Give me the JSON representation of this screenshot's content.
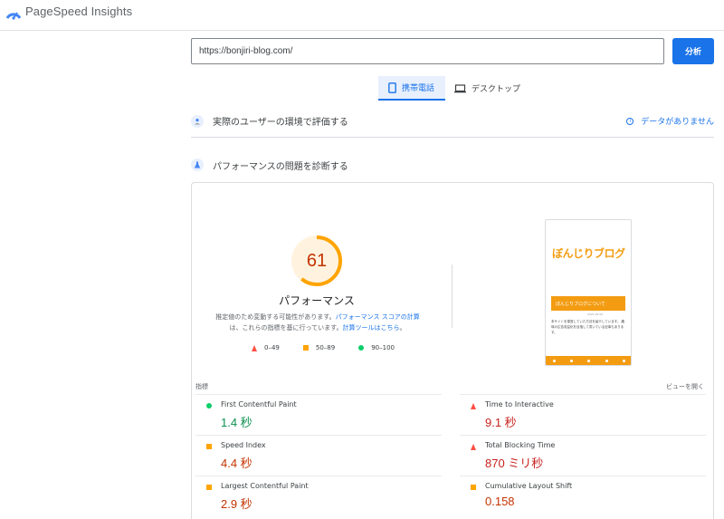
{
  "header": {
    "brand": "PageSpeed Insights"
  },
  "search": {
    "url": "https://bonjiri-blog.com/",
    "analyze_label": "分析"
  },
  "tabs": [
    {
      "label": "携帯電話",
      "active": true
    },
    {
      "label": "デスクトップ",
      "active": false
    }
  ],
  "field_section": {
    "title": "実際のユーザーの環境で評価する",
    "no_data": "データがありません"
  },
  "lab_section": {
    "title": "パフォーマンスの問題を診断する"
  },
  "performance": {
    "score": "61",
    "score_fraction": 0.61,
    "label": "パフォーマンス",
    "desc_1": "推定値のため変動する可能性があります。",
    "desc_link_1": "パフォーマンス スコアの計算",
    "desc_2": "は、これらの指標を基に行っています。",
    "desc_link_2": "計算ツールはこちら",
    "desc_end": "。"
  },
  "legend": [
    {
      "range": "0–49",
      "shape": "triangle",
      "color": "#ff4e42"
    },
    {
      "range": "50–89",
      "shape": "square",
      "color": "#ffa400"
    },
    {
      "range": "90–100",
      "shape": "circle",
      "color": "#0cce6b"
    }
  ],
  "thumbnail": {
    "logo": "ぼんじりブログ",
    "banner": "ぼんじりブログについて",
    "date": "2021.00.00",
    "text": "本サイトを運営していた方法を紹介しています。 趣味の広告収益化を目指して書いている記事もあります。"
  },
  "metrics": {
    "heading": "指標",
    "expand_label": "ビューを開く",
    "items": [
      {
        "name": "First Contentful Paint",
        "value": "1.4 秒",
        "status": "good"
      },
      {
        "name": "Time to Interactive",
        "value": "9.1 秒",
        "status": "poor"
      },
      {
        "name": "Speed Index",
        "value": "4.4 秒",
        "status": "average"
      },
      {
        "name": "Total Blocking Time",
        "value": "870 ミリ秒",
        "status": "poor"
      },
      {
        "name": "Largest Contentful Paint",
        "value": "2.9 秒",
        "status": "average"
      },
      {
        "name": "Cumulative Layout Shift",
        "value": "0.158",
        "status": "average"
      }
    ]
  },
  "colors": {
    "accent": "#1a73e8",
    "good": "#0cce6b",
    "average": "#ffa400",
    "poor": "#ff4e42"
  }
}
